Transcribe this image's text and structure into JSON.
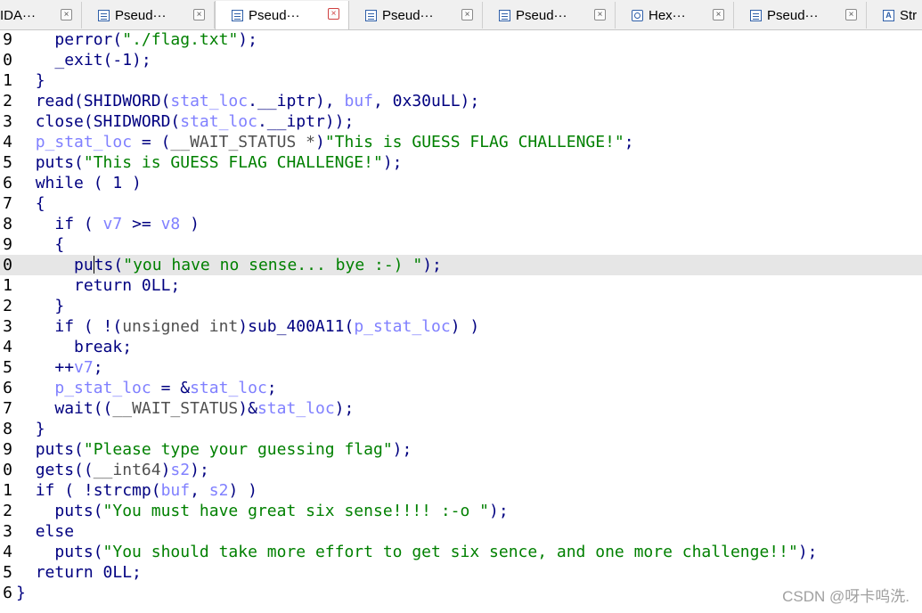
{
  "tabs": [
    {
      "label": "IDA···",
      "icon": "none",
      "active": false
    },
    {
      "label": "Pseud···",
      "icon": "pseudocode-icon",
      "active": false
    },
    {
      "label": "Pseud···",
      "icon": "pseudocode-icon",
      "active": true
    },
    {
      "label": "Pseud···",
      "icon": "pseudocode-icon",
      "active": false
    },
    {
      "label": "Pseud···",
      "icon": "pseudocode-icon",
      "active": false
    },
    {
      "label": "Hex···",
      "icon": "hex-view-icon",
      "active": false
    },
    {
      "label": "Pseud···",
      "icon": "pseudocode-icon",
      "active": false
    },
    {
      "label": "Str",
      "icon": "strings-icon",
      "active": false
    }
  ],
  "colors": {
    "keyword": "#000080",
    "string": "#008000",
    "variable": "#8080ff",
    "type": "#505050",
    "current_line": "#e6e6e6"
  },
  "current_line_index": 11,
  "lines": [
    {
      "n": "9",
      "tokens": [
        [
          "    ",
          ""
        ],
        [
          "perror",
          "k"
        ],
        [
          "(",
          "k"
        ],
        [
          "\"./flag.txt\"",
          "s"
        ],
        [
          ");",
          "k"
        ]
      ]
    },
    {
      "n": "0",
      "tokens": [
        [
          "    ",
          ""
        ],
        [
          "_exit",
          "k"
        ],
        [
          "(-1);",
          "k"
        ]
      ]
    },
    {
      "n": "1",
      "tokens": [
        [
          "  ",
          ""
        ],
        [
          "}",
          "k"
        ]
      ]
    },
    {
      "n": "2",
      "tokens": [
        [
          "  ",
          ""
        ],
        [
          "read(SHIDWORD(",
          "k"
        ],
        [
          "stat_loc",
          "v"
        ],
        [
          ".__iptr), ",
          "k"
        ],
        [
          "buf",
          "v"
        ],
        [
          ", 0x30uLL);",
          "k"
        ]
      ]
    },
    {
      "n": "3",
      "tokens": [
        [
          "  ",
          ""
        ],
        [
          "close(SHIDWORD(",
          "k"
        ],
        [
          "stat_loc",
          "v"
        ],
        [
          ".__iptr));",
          "k"
        ]
      ]
    },
    {
      "n": "4",
      "tokens": [
        [
          "  ",
          ""
        ],
        [
          "p_stat_loc",
          "v"
        ],
        [
          " = (",
          "k"
        ],
        [
          "__WAIT_STATUS *",
          "t"
        ],
        [
          ")",
          "k"
        ],
        [
          "\"This is GUESS FLAG CHALLENGE!\"",
          "s"
        ],
        [
          ";",
          "k"
        ]
      ]
    },
    {
      "n": "5",
      "tokens": [
        [
          "  ",
          ""
        ],
        [
          "puts(",
          "k"
        ],
        [
          "\"This is GUESS FLAG CHALLENGE!\"",
          "s"
        ],
        [
          ");",
          "k"
        ]
      ]
    },
    {
      "n": "6",
      "tokens": [
        [
          "  ",
          ""
        ],
        [
          "while ( 1 )",
          "k"
        ]
      ]
    },
    {
      "n": "7",
      "tokens": [
        [
          "  ",
          ""
        ],
        [
          "{",
          "k"
        ]
      ]
    },
    {
      "n": "8",
      "tokens": [
        [
          "    ",
          ""
        ],
        [
          "if ( ",
          "k"
        ],
        [
          "v7",
          "v"
        ],
        [
          " >= ",
          "k"
        ],
        [
          "v8",
          "v"
        ],
        [
          " )",
          "k"
        ]
      ]
    },
    {
      "n": "9",
      "tokens": [
        [
          "    ",
          ""
        ],
        [
          "{",
          "k"
        ]
      ]
    },
    {
      "n": "0",
      "tokens": [
        [
          "      ",
          ""
        ],
        [
          "pu",
          "k"
        ],
        [
          "|",
          "c"
        ],
        [
          "ts(",
          "k"
        ],
        [
          "\"you have no sense... bye :-) \"",
          "s"
        ],
        [
          ");",
          "k"
        ]
      ]
    },
    {
      "n": "1",
      "tokens": [
        [
          "      ",
          ""
        ],
        [
          "return 0LL;",
          "k"
        ]
      ]
    },
    {
      "n": "2",
      "tokens": [
        [
          "    ",
          ""
        ],
        [
          "}",
          "k"
        ]
      ]
    },
    {
      "n": "3",
      "tokens": [
        [
          "    ",
          ""
        ],
        [
          "if ( !(",
          "k"
        ],
        [
          "unsigned int",
          "t"
        ],
        [
          ")sub_400A11(",
          "k"
        ],
        [
          "p_stat_loc",
          "v"
        ],
        [
          ") )",
          "k"
        ]
      ]
    },
    {
      "n": "4",
      "tokens": [
        [
          "      ",
          ""
        ],
        [
          "break;",
          "k"
        ]
      ]
    },
    {
      "n": "5",
      "tokens": [
        [
          "    ",
          ""
        ],
        [
          "++",
          "k"
        ],
        [
          "v7",
          "v"
        ],
        [
          ";",
          "k"
        ]
      ]
    },
    {
      "n": "6",
      "tokens": [
        [
          "    ",
          ""
        ],
        [
          "p_stat_loc",
          "v"
        ],
        [
          " = &",
          "k"
        ],
        [
          "stat_loc",
          "v"
        ],
        [
          ";",
          "k"
        ]
      ]
    },
    {
      "n": "7",
      "tokens": [
        [
          "    ",
          ""
        ],
        [
          "wait((",
          "k"
        ],
        [
          "__WAIT_STATUS",
          "t"
        ],
        [
          ")&",
          "k"
        ],
        [
          "stat_loc",
          "v"
        ],
        [
          ");",
          "k"
        ]
      ]
    },
    {
      "n": "8",
      "tokens": [
        [
          "  ",
          ""
        ],
        [
          "}",
          "k"
        ]
      ]
    },
    {
      "n": "9",
      "tokens": [
        [
          "  ",
          ""
        ],
        [
          "puts(",
          "k"
        ],
        [
          "\"Please type your guessing flag\"",
          "s"
        ],
        [
          ");",
          "k"
        ]
      ]
    },
    {
      "n": "0",
      "tokens": [
        [
          "  ",
          ""
        ],
        [
          "gets((",
          "k"
        ],
        [
          "__int64",
          "t"
        ],
        [
          ")",
          "k"
        ],
        [
          "s2",
          "v"
        ],
        [
          ");",
          "k"
        ]
      ]
    },
    {
      "n": "1",
      "tokens": [
        [
          "  ",
          ""
        ],
        [
          "if ( !strcmp(",
          "k"
        ],
        [
          "buf",
          "v"
        ],
        [
          ", ",
          "k"
        ],
        [
          "s2",
          "v"
        ],
        [
          ") )",
          "k"
        ]
      ]
    },
    {
      "n": "2",
      "tokens": [
        [
          "    ",
          ""
        ],
        [
          "puts(",
          "k"
        ],
        [
          "\"You must have great six sense!!!! :-o \"",
          "s"
        ],
        [
          ");",
          "k"
        ]
      ]
    },
    {
      "n": "3",
      "tokens": [
        [
          "  ",
          ""
        ],
        [
          "else",
          "k"
        ]
      ]
    },
    {
      "n": "4",
      "tokens": [
        [
          "    ",
          ""
        ],
        [
          "puts(",
          "k"
        ],
        [
          "\"You should take more effort to get six sence, and one more challenge!!\"",
          "s"
        ],
        [
          ");",
          "k"
        ]
      ]
    },
    {
      "n": "5",
      "tokens": [
        [
          "  ",
          ""
        ],
        [
          "return 0LL;",
          "k"
        ]
      ]
    },
    {
      "n": "6",
      "tokens": [
        [
          "",
          ""
        ],
        [
          "}",
          "k"
        ]
      ]
    }
  ],
  "watermark": "CSDN @呀卡呜洗."
}
